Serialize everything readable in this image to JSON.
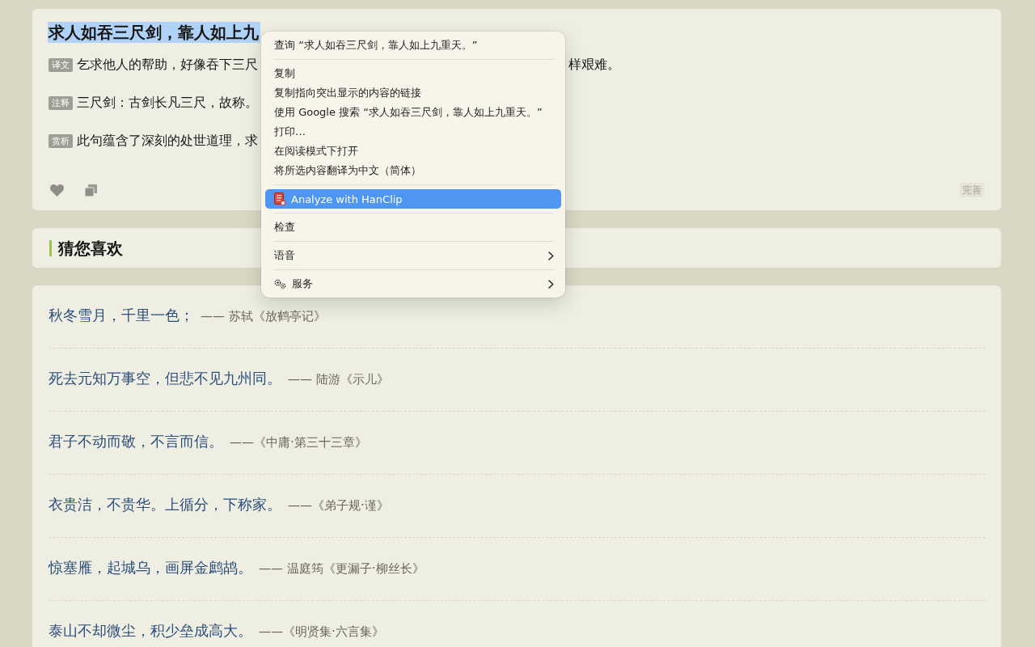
{
  "poem_card": {
    "title": "求人如吞三尺剑，靠人如上九",
    "title_selected": true,
    "sections": [
      {
        "tag": "译文",
        "text": "乞求他人的帮助，好像吞下三尺",
        "text_after": "样艰难。"
      },
      {
        "tag": "注释",
        "text": "三尺剑：古剑长凡三尺，故称。"
      },
      {
        "tag": "赏析",
        "text": "此句蕴含了深刻的处世道理，求"
      }
    ],
    "improve_button": "完善"
  },
  "recommend": {
    "heading": "猜您喜欢"
  },
  "quotes": [
    {
      "text": "秋冬雪月，千里一色；",
      "source": "—— 苏轼《放鹤亭记》"
    },
    {
      "text": "死去元知万事空，但悲不见九州同。",
      "source": "—— 陆游《示儿》"
    },
    {
      "text": "君子不动而敬，不言而信。",
      "source": "——《中庸·第三十三章》"
    },
    {
      "text": "衣贵洁，不贵华。上循分，下称家。",
      "source": "——《弟子规·谨》"
    },
    {
      "text": "惊塞雁，起城乌，画屏金鹧鸪。",
      "source": "—— 温庭筠《更漏子·柳丝长》"
    },
    {
      "text": "泰山不却微尘，积少垒成高大。",
      "source": "——《明贤集·六言集》"
    }
  ],
  "context_menu": {
    "groups": [
      [
        {
          "label": "查询 “求人如吞三尺剑，靠人如上九重天。”",
          "kind": "action",
          "selected": false
        }
      ],
      [
        {
          "label": "复制",
          "kind": "action",
          "selected": false
        },
        {
          "label": "复制指向突出显示的内容的链接",
          "kind": "action",
          "selected": false
        },
        {
          "label": "使用 Google 搜索 “求人如吞三尺剑，靠人如上九重天。”",
          "kind": "action",
          "selected": false
        },
        {
          "label": "打印…",
          "kind": "action",
          "selected": false
        },
        {
          "label": "在阅读模式下打开",
          "kind": "action",
          "selected": false
        },
        {
          "label": "将所选内容翻译为中文（简体）",
          "kind": "action",
          "selected": false
        }
      ],
      [
        {
          "label": "Analyze with HanClip",
          "kind": "extension",
          "selected": true
        }
      ],
      [
        {
          "label": "检查",
          "kind": "action",
          "selected": false
        }
      ],
      [
        {
          "label": "语音",
          "kind": "submenu",
          "selected": false
        }
      ],
      [
        {
          "label": "服务",
          "kind": "services",
          "selected": false
        }
      ]
    ]
  }
}
